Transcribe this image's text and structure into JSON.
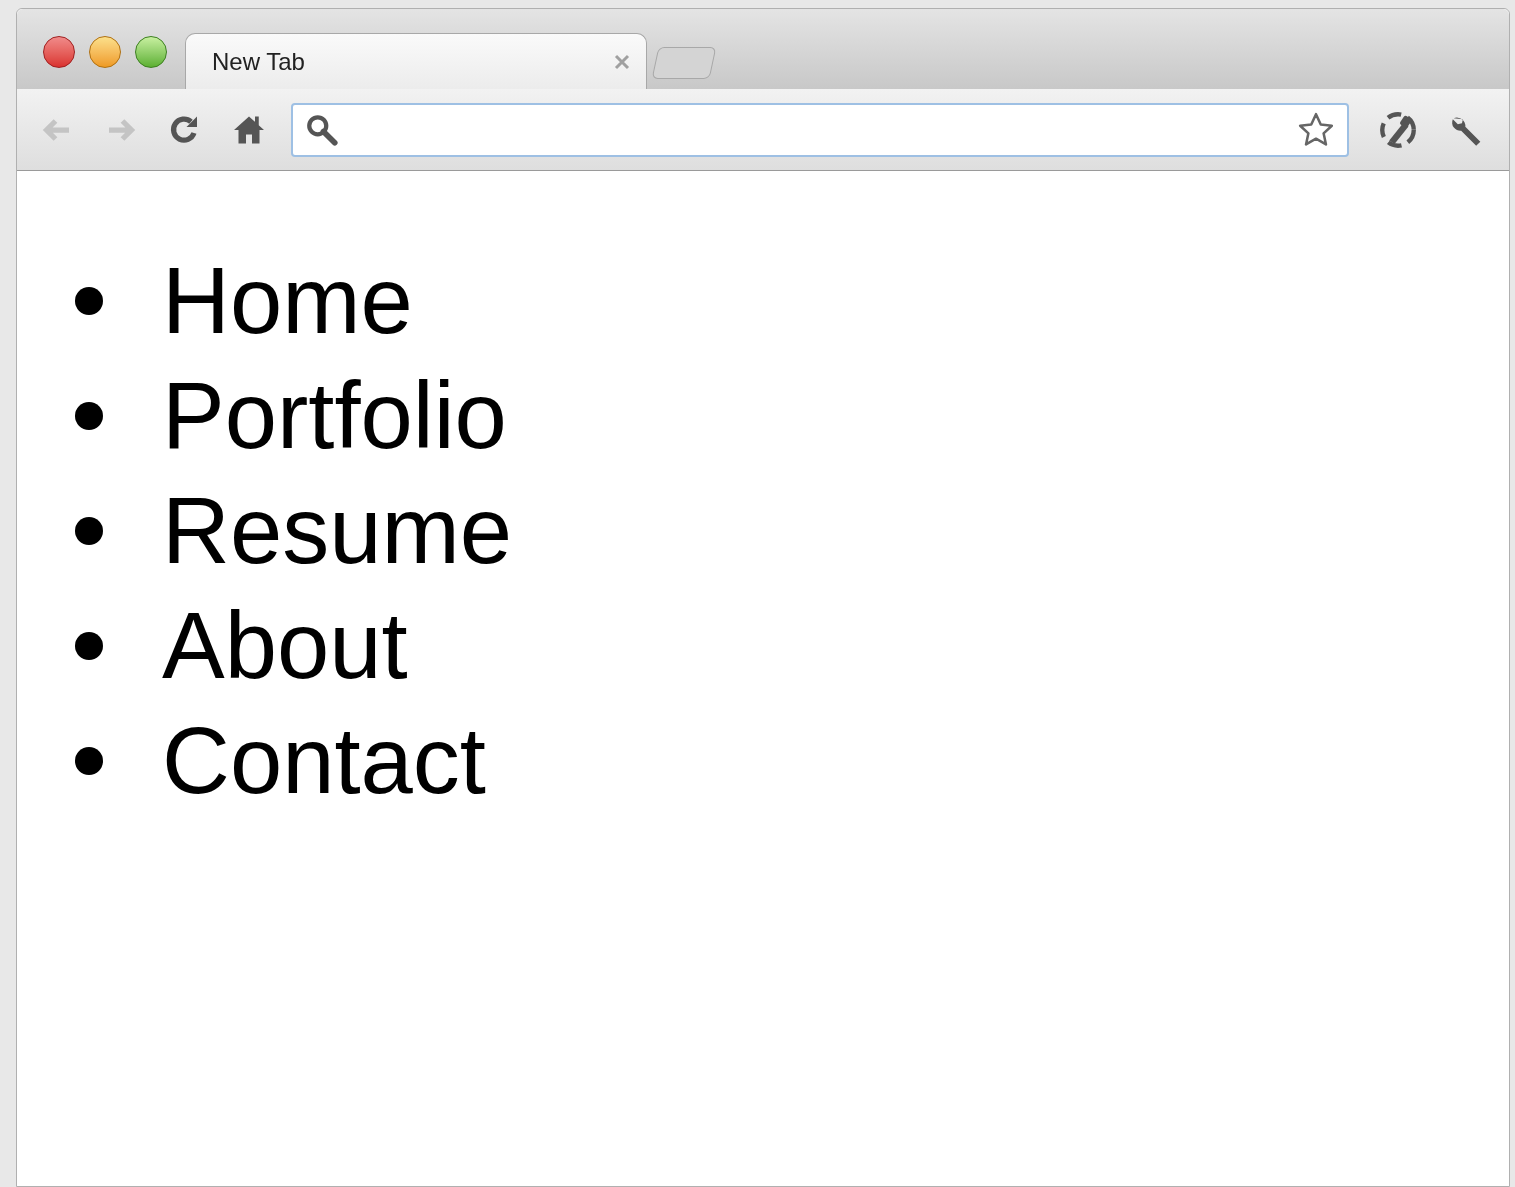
{
  "tabs": [
    {
      "title": "New Tab",
      "selected": true
    }
  ],
  "toolbar": {
    "buttons": [
      {
        "kind": "back",
        "disabled": true
      },
      {
        "kind": "forward",
        "disabled": true
      },
      {
        "kind": "reload",
        "disabled": false
      },
      {
        "kind": "home",
        "disabled": false
      }
    ]
  },
  "address_bar": {
    "bookmarked": false
  },
  "list": {
    "items": [
      "Home",
      "Portfolio",
      "Resume",
      "About",
      "Contact"
    ]
  }
}
